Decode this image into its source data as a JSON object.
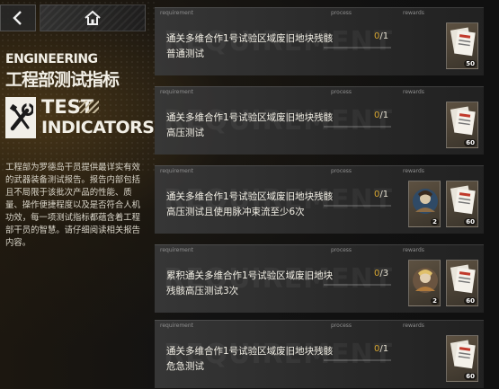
{
  "nav": {
    "back_icon": "chevron-left-icon",
    "home_icon": "home-icon"
  },
  "panel": {
    "title_en": "ENGINEERING",
    "title_cn": "工程部测试指标",
    "badge_line1": "TEST",
    "badge_line2": "INDICATORS",
    "badge_icon": "wrench-screwdriver-icon",
    "description": "工程部为罗德岛干员提供最详实有效的武器装备测试报告。报告内部包括且不局限于该批次产品的性能、质量、操作便捷程度以及是否符合人机功效，每一项测试指标都蕴含着工程部干员的智慧。请仔细阅读相关报告内容。"
  },
  "columns": {
    "requirement": "requirement",
    "process": "process",
    "rewards": "rewards",
    "watermark": "REQUIREMENT"
  },
  "tasks": [
    {
      "text": "通关多维合作1号试验区域废旧地块残骸普通测试",
      "current": "0",
      "total": "/1",
      "progress_fraction": 0,
      "rewards": [
        {
          "icon": "report-document-icon",
          "count": "50"
        }
      ]
    },
    {
      "text": "通关多维合作1号试验区域废旧地块残骸高压测试",
      "current": "0",
      "total": "/1",
      "progress_fraction": 0,
      "rewards": [
        {
          "icon": "report-document-icon",
          "count": "60"
        }
      ]
    },
    {
      "text": "通关多维合作1号试验区域废旧地块残骸高压测试且使用脉冲束流至少6次",
      "current": "0",
      "total": "/1",
      "progress_fraction": 0,
      "rewards": [
        {
          "icon": "operator-avatar-icon",
          "count": "2"
        },
        {
          "icon": "report-document-icon",
          "count": "60"
        }
      ]
    },
    {
      "text": "累积通关多维合作1号试验区域废旧地块残骸高压测试3次",
      "current": "0",
      "total": "/3",
      "progress_fraction": 0,
      "rewards": [
        {
          "icon": "operator-avatar-icon",
          "count": "2"
        },
        {
          "icon": "report-document-icon",
          "count": "60"
        }
      ]
    },
    {
      "text": "通关多维合作1号试验区域废旧地块残骸危急测试",
      "current": "0",
      "total": "/1",
      "progress_fraction": 0,
      "rewards": [
        {
          "icon": "report-document-icon",
          "count": "60"
        }
      ]
    }
  ],
  "colors": {
    "accent": "#d6a530",
    "card": "#333333",
    "text": "#f3f0e6"
  }
}
